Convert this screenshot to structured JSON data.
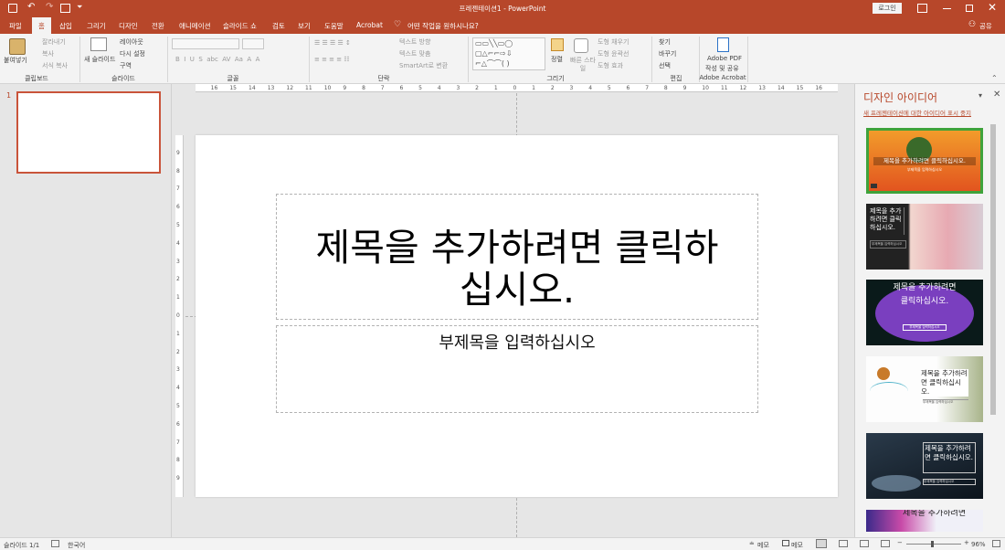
{
  "titlebar": {
    "title": "프레젠테이션1 - PowerPoint",
    "login_label": "로그인"
  },
  "tabs": [
    "파일",
    "홈",
    "삽입",
    "그리기",
    "디자인",
    "전환",
    "애니메이션",
    "슬라이드 쇼",
    "검토",
    "보기",
    "도움말",
    "Acrobat"
  ],
  "tell_me": "어떤 작업을 원하시나요?",
  "share_label": "공유",
  "ribbon": {
    "clipboard": {
      "paste": "붙여넣기",
      "cut": "잘라내기",
      "copy": "복사",
      "format_painter": "서식 복사",
      "group": "클립보드"
    },
    "slides": {
      "new_slide": "새 슬라이드",
      "layout": "레이아웃",
      "reset": "다시 설정",
      "section": "구역",
      "group": "슬라이드"
    },
    "font": {
      "group": "글꼴"
    },
    "paragraph": {
      "text_direction": "텍스트 방향",
      "align_text": "텍스트 맞춤",
      "smartart": "SmartArt로 변환",
      "group": "단락"
    },
    "drawing": {
      "arrange": "정렬",
      "quick_styles": "빠른 스타일",
      "shape_fill": "도형 채우기",
      "shape_outline": "도형 윤곽선",
      "shape_effects": "도형 효과",
      "group": "그리기"
    },
    "editing": {
      "find": "찾기",
      "replace": "바꾸기",
      "select": "선택",
      "group": "편집"
    },
    "acrobat": {
      "create_pdf_line1": "Adobe PDF",
      "create_pdf_line2": "작성 및 공유",
      "group": "Adobe Acrobat"
    }
  },
  "slide_thumbnail_number": "1",
  "slide": {
    "title_line1": "제목을 추가하려면 클릭하",
    "title_line2": "십시오.",
    "subtitle": "부제목을 입력하십시오"
  },
  "ruler_h": [
    "16",
    "15",
    "14",
    "13",
    "12",
    "11",
    "10",
    "9",
    "8",
    "7",
    "6",
    "5",
    "4",
    "3",
    "2",
    "1",
    "0",
    "1",
    "2",
    "3",
    "4",
    "5",
    "6",
    "7",
    "8",
    "9",
    "10",
    "11",
    "12",
    "13",
    "14",
    "15",
    "16"
  ],
  "ruler_v": [
    "9",
    "8",
    "7",
    "6",
    "5",
    "4",
    "3",
    "2",
    "1",
    "0",
    "1",
    "2",
    "3",
    "4",
    "5",
    "6",
    "7",
    "8",
    "9"
  ],
  "design_ideas": {
    "title": "디자인 아이디어",
    "link": "새 프레젠테이션에 대한 아이디어 표시 중지",
    "cards": [
      {
        "title": "제목을 추가하려면 클릭하십시오.",
        "subtitle": "부제목을 입력하십시오"
      },
      {
        "title": "제목을 추가하려면 클릭하십시오.",
        "subtitle": "부제목을 입력하십시오"
      },
      {
        "title": "제목을 추가하려면 클릭하십시오.",
        "subtitle": "부제목을 입력하십시오"
      },
      {
        "title": "제목을 추가하려면 클릭하십시오.",
        "subtitle": "부제목을 입력하십시오"
      },
      {
        "title": "제목을 추가하려면 클릭하십시오.",
        "subtitle": "부제목을 입력하십시오"
      },
      {
        "title": "제목을 추가하려면",
        "subtitle": ""
      }
    ]
  },
  "status": {
    "slide_count": "슬라이드 1/1",
    "language": "한국어",
    "notes": "메모",
    "comments": "메모",
    "zoom": "96%"
  },
  "colors": {
    "accent": "#b7472a",
    "ribbon_bg": "#f3f3f3",
    "workspace": "#e6e6e6"
  }
}
